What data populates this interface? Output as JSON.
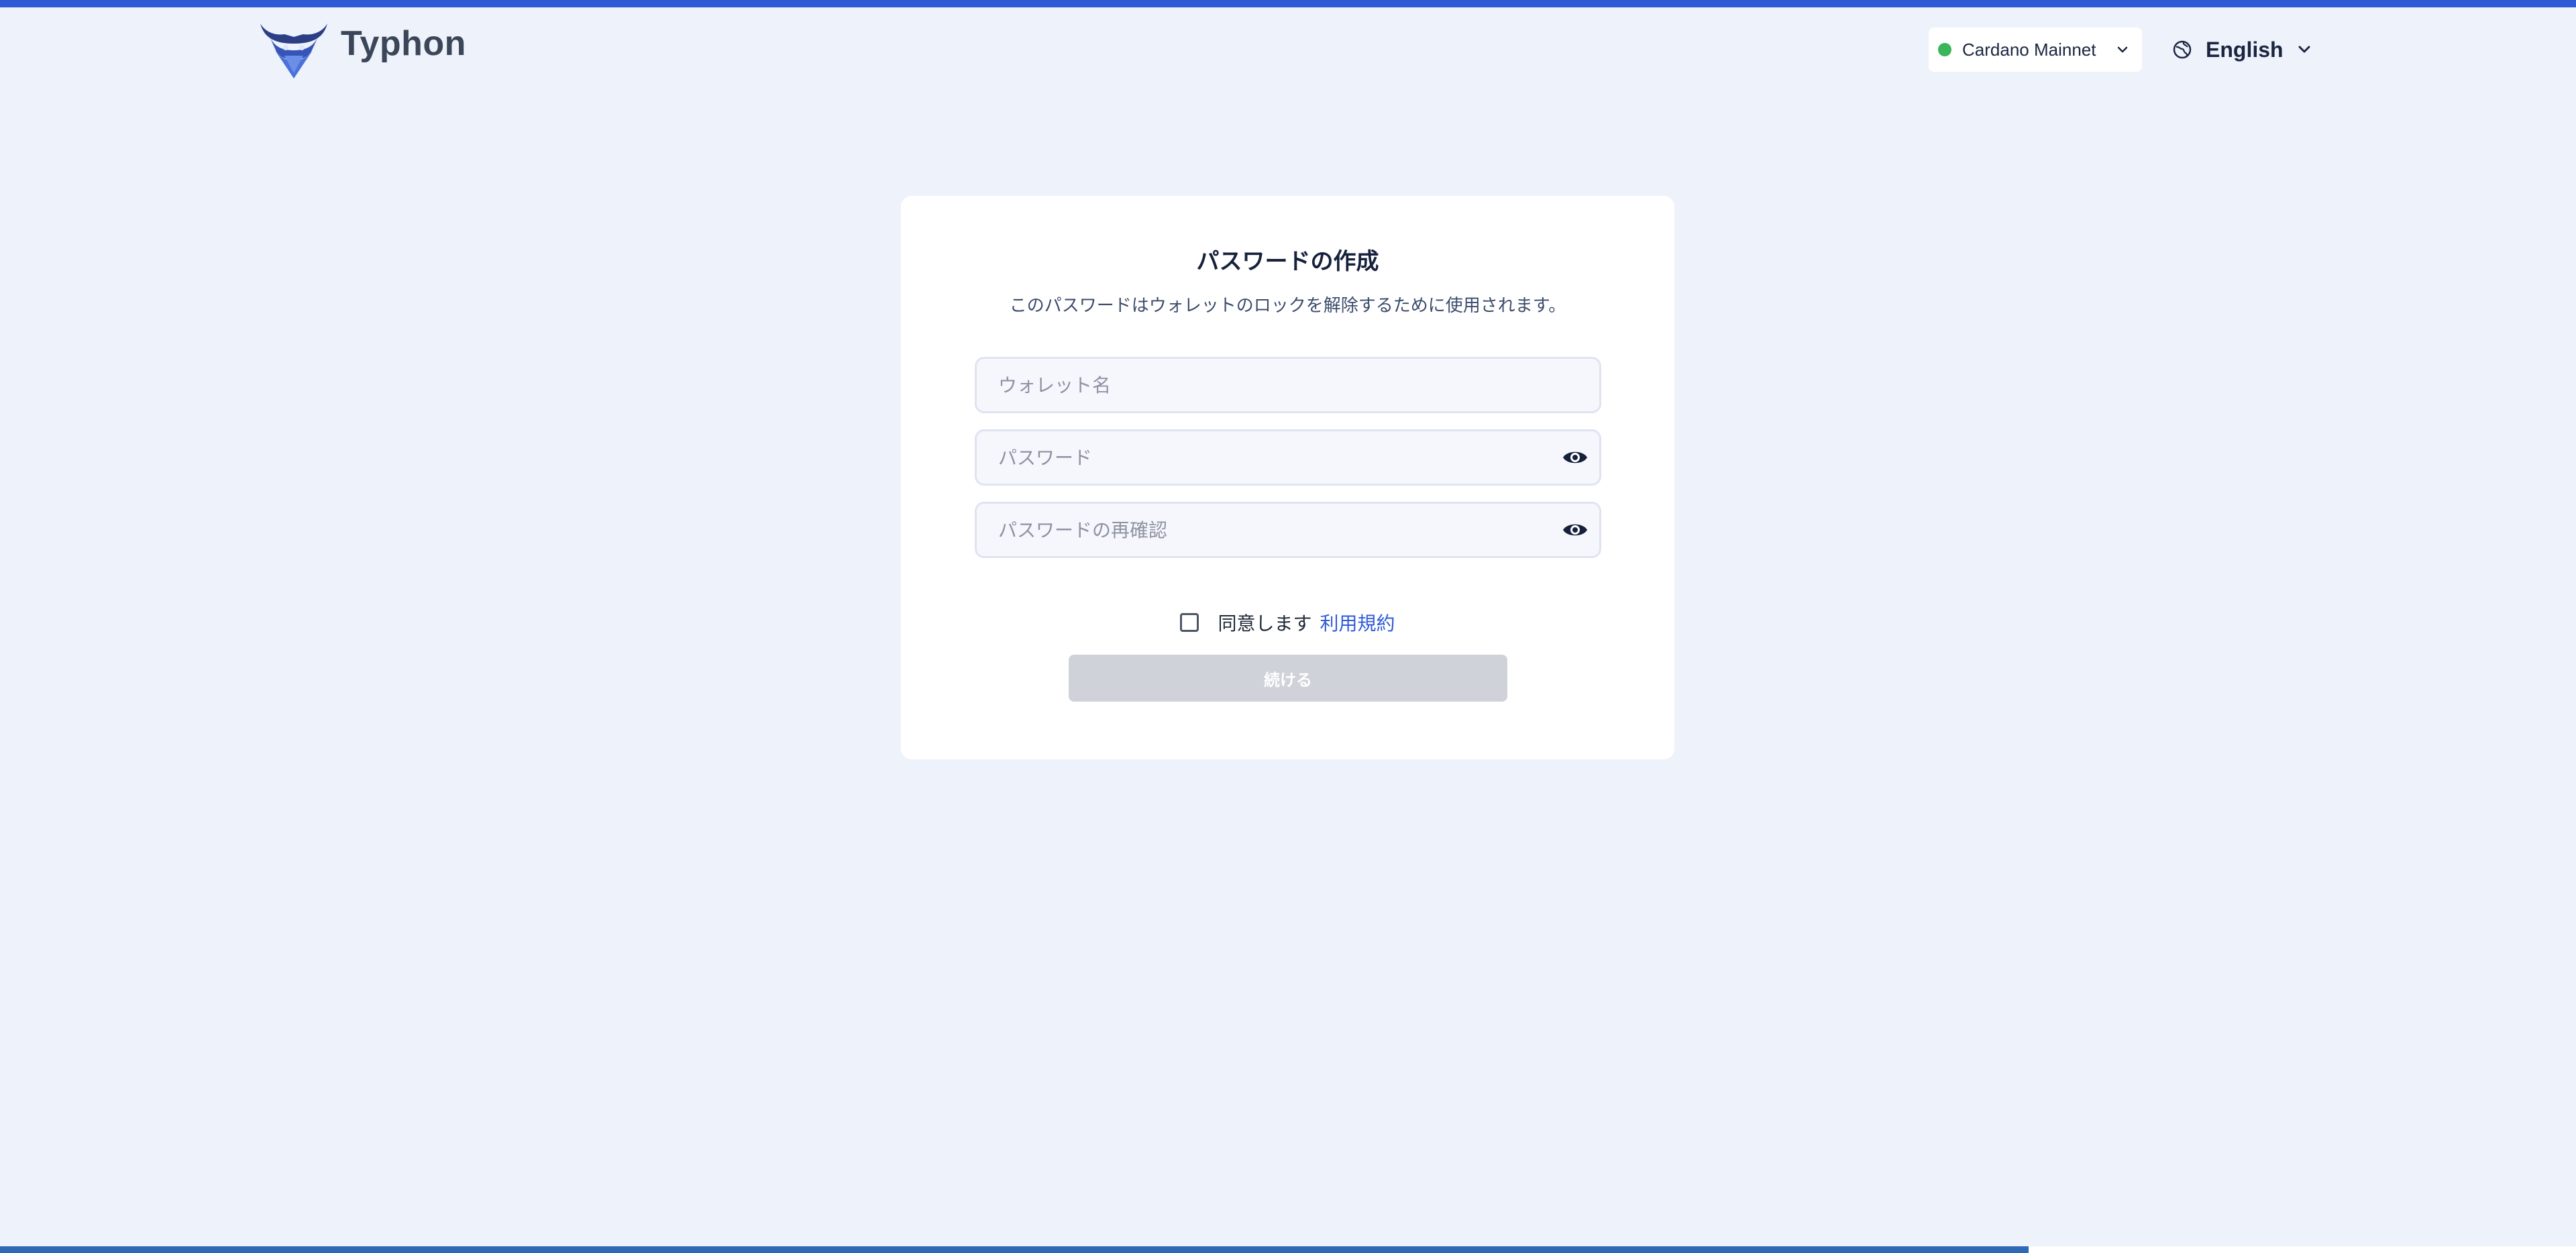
{
  "header": {
    "brand": "Typhon",
    "network_label": "Cardano Mainnet",
    "network_status_color": "#3ab55a",
    "language_label": "English",
    "icons": [
      "typhon-logo",
      "chevron-down-icon",
      "globe-icon"
    ]
  },
  "card": {
    "title": "パスワードの作成",
    "subtitle": "このパスワードはウォレットのロックを解除するために使用されます。",
    "fields": {
      "wallet_name": {
        "value": "",
        "placeholder": "ウォレット名"
      },
      "password": {
        "value": "",
        "placeholder": "パスワード"
      },
      "password_confirm": {
        "value": "",
        "placeholder": "パスワードの再確認"
      }
    },
    "agree_text": "同意します",
    "terms_link": "利用規約",
    "continue_label": "続ける",
    "agree_checked": false
  },
  "colors": {
    "accent": "#2f5bd6",
    "background": "#eef2fb",
    "disabled_button": "#cfd2d8"
  }
}
